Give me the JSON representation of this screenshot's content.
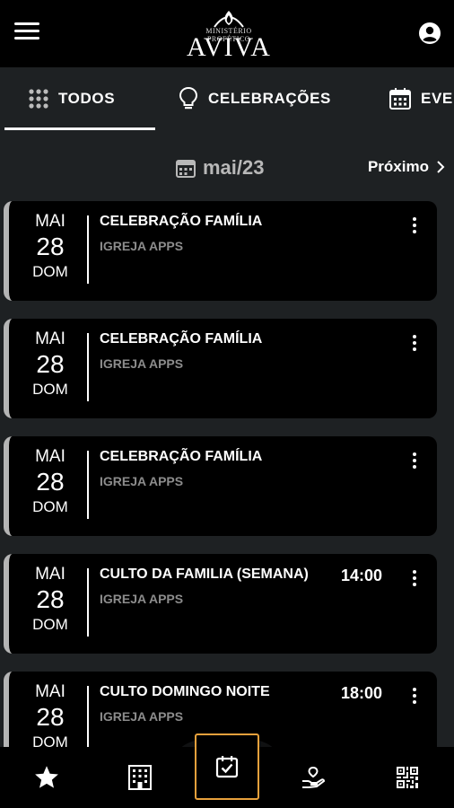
{
  "header": {
    "logo_sub": "MINISTÉRIO PROFÉTICO",
    "logo_main": "AVIVA"
  },
  "tabs": [
    {
      "label": "TODOS",
      "icon": "grid-dots-icon",
      "active": true
    },
    {
      "label": "CELEBRAÇÕES",
      "icon": "lightbulb-icon",
      "active": false
    },
    {
      "label": "EVE",
      "icon": "calendar-grid-icon",
      "active": false
    }
  ],
  "month_nav": {
    "label": "mai/23",
    "next_label": "Próximo"
  },
  "events": [
    {
      "month": "MAI",
      "day": "28",
      "weekday": "DOM",
      "title": "CELEBRAÇÃO FAMÍLIA",
      "org": "IGREJA APPS",
      "time": ""
    },
    {
      "month": "MAI",
      "day": "28",
      "weekday": "DOM",
      "title": "CELEBRAÇÃO FAMÍLIA",
      "org": "IGREJA APPS",
      "time": ""
    },
    {
      "month": "MAI",
      "day": "28",
      "weekday": "DOM",
      "title": "CELEBRAÇÃO FAMÍLIA",
      "org": "IGREJA APPS",
      "time": ""
    },
    {
      "month": "MAI",
      "day": "28",
      "weekday": "DOM",
      "title": "CULTO DA FAMILIA (SEMANA)",
      "org": "IGREJA APPS",
      "time": "14:00"
    },
    {
      "month": "MAI",
      "day": "28",
      "weekday": "DOM",
      "title": "CULTO DOMINGO NOITE",
      "org": "IGREJA APPS",
      "time": "18:00"
    }
  ],
  "bottom_nav": [
    {
      "icon": "star-icon",
      "active": false
    },
    {
      "icon": "building-icon",
      "active": false
    },
    {
      "icon": "calendar-check-icon",
      "active": true
    },
    {
      "icon": "giving-hand-icon",
      "active": false
    },
    {
      "icon": "qr-code-icon",
      "active": false
    }
  ],
  "colors": {
    "background": "#1e2123",
    "card": "#000000",
    "accent_active_nav": "#e8a13c",
    "muted_text": "#8c8c8c"
  }
}
